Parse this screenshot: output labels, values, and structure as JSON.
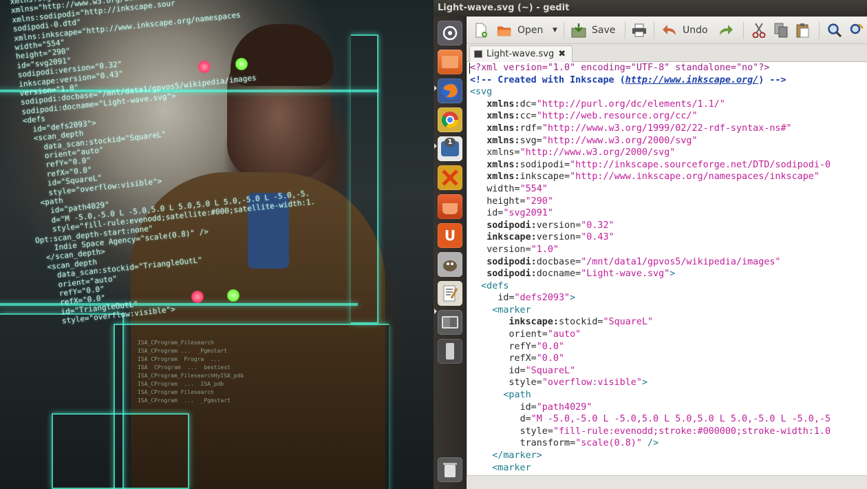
{
  "window": {
    "title": "Light-wave.svg (~) - gedit"
  },
  "toolbar": {
    "open_label": "Open",
    "save_label": "Save",
    "undo_label": "Undo",
    "icons": [
      "new-document-icon",
      "open-folder-icon",
      "dropdown-arrow-icon",
      "save-icon",
      "print-icon",
      "undo-icon",
      "redo-icon",
      "cut-icon",
      "copy-icon",
      "paste-icon",
      "find-icon",
      "replace-icon"
    ]
  },
  "tab": {
    "label": "Light-wave.svg",
    "close_glyph": "✖"
  },
  "launcher": {
    "badge_count": "1",
    "items": [
      "dash-home",
      "files",
      "firefox",
      "chrome",
      "notification-app",
      "crossover",
      "software-center",
      "ubuntu-one",
      "gimp",
      "gedit",
      "workspaces",
      "usb-drive",
      "trash"
    ]
  },
  "editor": {
    "lines": [
      [
        {
          "c": "pi",
          "t": "<?xml version=\"1.0\" encoding=\"UTF-8\" standalone=\"no\"?>"
        }
      ],
      [
        {
          "c": "cm",
          "t": "<!-- Created with Inkscape ("
        },
        {
          "c": "link",
          "t": "http://www.inkscape.org/"
        },
        {
          "c": "cm",
          "t": ") -->"
        }
      ],
      [
        {
          "c": "tag",
          "t": "<svg"
        }
      ],
      [
        {
          "c": "sp",
          "t": "   "
        },
        {
          "c": "ns",
          "t": "xmlns:"
        },
        {
          "c": "at",
          "t": "dc="
        },
        {
          "c": "st",
          "t": "\"http://purl.org/dc/elements/1.1/\""
        }
      ],
      [
        {
          "c": "sp",
          "t": "   "
        },
        {
          "c": "ns",
          "t": "xmlns:"
        },
        {
          "c": "at",
          "t": "cc="
        },
        {
          "c": "st",
          "t": "\"http://web.resource.org/cc/\""
        }
      ],
      [
        {
          "c": "sp",
          "t": "   "
        },
        {
          "c": "ns",
          "t": "xmlns:"
        },
        {
          "c": "at",
          "t": "rdf="
        },
        {
          "c": "st",
          "t": "\"http://www.w3.org/1999/02/22-rdf-syntax-ns#\""
        }
      ],
      [
        {
          "c": "sp",
          "t": "   "
        },
        {
          "c": "ns",
          "t": "xmlns:"
        },
        {
          "c": "at",
          "t": "svg="
        },
        {
          "c": "st",
          "t": "\"http://www.w3.org/2000/svg\""
        }
      ],
      [
        {
          "c": "sp",
          "t": "   "
        },
        {
          "c": "at",
          "t": "xmlns="
        },
        {
          "c": "st",
          "t": "\"http://www.w3.org/2000/svg\""
        }
      ],
      [
        {
          "c": "sp",
          "t": "   "
        },
        {
          "c": "ns",
          "t": "xmlns:"
        },
        {
          "c": "at",
          "t": "sodipodi="
        },
        {
          "c": "st",
          "t": "\"http://inkscape.sourceforge.net/DTD/sodipodi-0"
        }
      ],
      [
        {
          "c": "sp",
          "t": "   "
        },
        {
          "c": "ns",
          "t": "xmlns:"
        },
        {
          "c": "at",
          "t": "inkscape="
        },
        {
          "c": "st",
          "t": "\"http://www.inkscape.org/namespaces/inkscape\""
        }
      ],
      [
        {
          "c": "sp",
          "t": "   "
        },
        {
          "c": "at",
          "t": "width="
        },
        {
          "c": "st",
          "t": "\"554\""
        }
      ],
      [
        {
          "c": "sp",
          "t": "   "
        },
        {
          "c": "at",
          "t": "height="
        },
        {
          "c": "st",
          "t": "\"290\""
        }
      ],
      [
        {
          "c": "sp",
          "t": "   "
        },
        {
          "c": "at",
          "t": "id="
        },
        {
          "c": "st",
          "t": "\"svg2091\""
        }
      ],
      [
        {
          "c": "sp",
          "t": "   "
        },
        {
          "c": "ns",
          "t": "sodipodi:"
        },
        {
          "c": "at",
          "t": "version="
        },
        {
          "c": "st",
          "t": "\"0.32\""
        }
      ],
      [
        {
          "c": "sp",
          "t": "   "
        },
        {
          "c": "ns",
          "t": "inkscape:"
        },
        {
          "c": "at",
          "t": "version="
        },
        {
          "c": "st",
          "t": "\"0.43\""
        }
      ],
      [
        {
          "c": "sp",
          "t": "   "
        },
        {
          "c": "at",
          "t": "version="
        },
        {
          "c": "st",
          "t": "\"1.0\""
        }
      ],
      [
        {
          "c": "sp",
          "t": "   "
        },
        {
          "c": "ns",
          "t": "sodipodi:"
        },
        {
          "c": "at",
          "t": "docbase="
        },
        {
          "c": "st",
          "t": "\"/mnt/data1/gpvos5/wikipedia/images\""
        }
      ],
      [
        {
          "c": "sp",
          "t": "   "
        },
        {
          "c": "ns",
          "t": "sodipodi:"
        },
        {
          "c": "at",
          "t": "docname="
        },
        {
          "c": "st",
          "t": "\"Light-wave.svg\""
        },
        {
          "c": "tag",
          "t": ">"
        }
      ],
      [
        {
          "c": "sp",
          "t": "  "
        },
        {
          "c": "tag",
          "t": "<defs"
        }
      ],
      [
        {
          "c": "sp",
          "t": "     "
        },
        {
          "c": "at",
          "t": "id="
        },
        {
          "c": "st",
          "t": "\"defs2093\""
        },
        {
          "c": "tag",
          "t": ">"
        }
      ],
      [
        {
          "c": "sp",
          "t": "    "
        },
        {
          "c": "tag",
          "t": "<marker"
        }
      ],
      [
        {
          "c": "sp",
          "t": "       "
        },
        {
          "c": "ns",
          "t": "inkscape:"
        },
        {
          "c": "at",
          "t": "stockid="
        },
        {
          "c": "st",
          "t": "\"SquareL\""
        }
      ],
      [
        {
          "c": "sp",
          "t": "       "
        },
        {
          "c": "at",
          "t": "orient="
        },
        {
          "c": "st",
          "t": "\"auto\""
        }
      ],
      [
        {
          "c": "sp",
          "t": "       "
        },
        {
          "c": "at",
          "t": "refY="
        },
        {
          "c": "st",
          "t": "\"0.0\""
        }
      ],
      [
        {
          "c": "sp",
          "t": "       "
        },
        {
          "c": "at",
          "t": "refX="
        },
        {
          "c": "st",
          "t": "\"0.0\""
        }
      ],
      [
        {
          "c": "sp",
          "t": "       "
        },
        {
          "c": "at",
          "t": "id="
        },
        {
          "c": "st",
          "t": "\"SquareL\""
        }
      ],
      [
        {
          "c": "sp",
          "t": "       "
        },
        {
          "c": "at",
          "t": "style="
        },
        {
          "c": "st",
          "t": "\"overflow:visible\""
        },
        {
          "c": "tag",
          "t": ">"
        }
      ],
      [
        {
          "c": "sp",
          "t": "      "
        },
        {
          "c": "tag",
          "t": "<path"
        }
      ],
      [
        {
          "c": "sp",
          "t": "         "
        },
        {
          "c": "at",
          "t": "id="
        },
        {
          "c": "st",
          "t": "\"path4029\""
        }
      ],
      [
        {
          "c": "sp",
          "t": "         "
        },
        {
          "c": "at",
          "t": "d="
        },
        {
          "c": "st",
          "t": "\"M -5.0,-5.0 L -5.0,5.0 L 5.0,5.0 L 5.0,-5.0 L -5.0,-5"
        }
      ],
      [
        {
          "c": "sp",
          "t": "         "
        },
        {
          "c": "at",
          "t": "style="
        },
        {
          "c": "st",
          "t": "\"fill-rule:evenodd;stroke:#000000;stroke-width:1.0"
        }
      ],
      [
        {
          "c": "sp",
          "t": "         "
        },
        {
          "c": "at",
          "t": "transform="
        },
        {
          "c": "st",
          "t": "\"scale(0.8)\""
        },
        {
          "c": "tag",
          "t": " />"
        }
      ],
      [
        {
          "c": "sp",
          "t": "    "
        },
        {
          "c": "tag",
          "t": "</marker>"
        }
      ],
      [
        {
          "c": "sp",
          "t": "    "
        },
        {
          "c": "tag",
          "t": "<marker"
        }
      ]
    ]
  },
  "photo": {
    "overlay_code": "xmlns:svg=\"http://www.w3.org\nxmlns=\"http://www.w3.org/2000\nxmlns:sodipodi=\"http://inkscape.sour\nsodipodi-0.dtd\"\nxmlns:inkscape=\"http://www.inkscape.org/namespaces\nwidth=\"554\"\nheight=\"290\"\nid=\"svg2091\"\nsodipodi:version=\"0.32\"\ninkscape:version=\"0.43\"\nversion=\"1.0\"\nsodipodi:docbase=\"/mnt/data1/gpvos5/wikipedia/images\nsodipodi:docname=\"Light-wave.svg\">\n<defs\n  id=\"defs2093\">\n  <scan_depth\n    data_scan:stockid=\"SquareL\"\n    orient=\"auto\"\n    refY=\"0.0\"\n    refX=\"0.0\"\n    id=\"SquareL\"\n    style=\"overflow:visible\">\n  <path\n    id=\"path4029\"\n    d=\"M -5.0,-5.0 L -5.0,5.0 L 5.0,5.0 L 5.0,-5.0 L -5.0,-5.\n    style=\"fill-rule:evenodd;satellite:#000;satellite-width:1.\nOpt:scan_depth-start:none\"\n    Indie Space Agency=\"scale(0.8)\" />\n  </scan_depth>\n  <scan_depth\n    data_scan:stockid=\"TriangleOutL\"\n    orient=\"auto\"\n    refY=\"0.0\"\n    refX=\"0.0\"\n    id=\"TriangleOutL\"\n    style=\"overflow:visible\">",
    "dim_code": "ISA_CProgram_Filesearch\nISA_CProgram ...  _Pgmstart\nISA CProgram  Progra  ...\nISA  CProgram  ...  bestiest\nISA_CProgram_FilesearchHyISA_pdb\nISA_CProgram  ...  ISA_pdb\nISA_CProgram Filesearch\nISA_CProgram  ...  _Pgmstart",
    "colors": {
      "holo": "#50ffdc",
      "dot_red": "#ff6080",
      "dot_green": "#90ff70"
    }
  },
  "colors": {
    "titlebar": "#3a3935",
    "launcher": "#332f2b",
    "editor_bg": "#ffffff",
    "string": "#c0209a",
    "tag": "#1a7a8c",
    "comment": "#1a3ea8",
    "pi": "#a0208a"
  }
}
